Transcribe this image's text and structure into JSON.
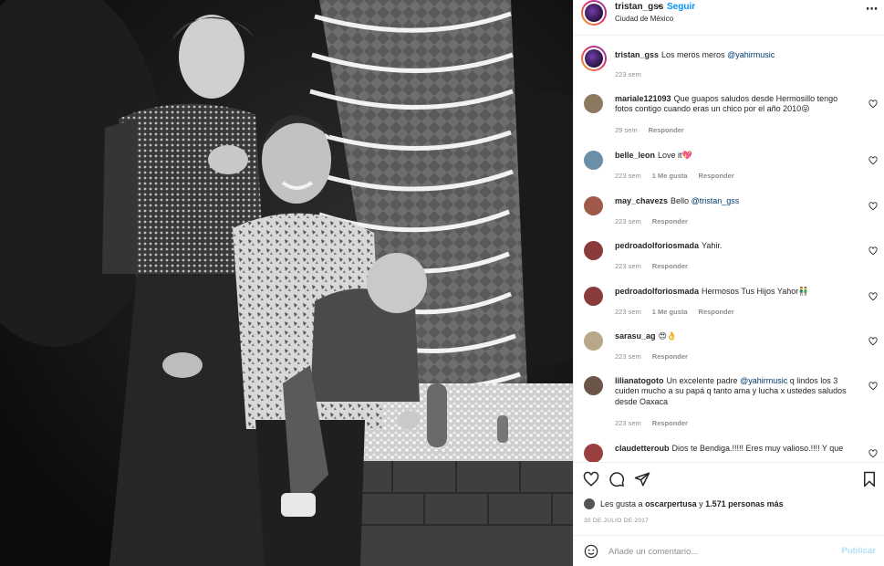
{
  "header": {
    "username": "tristan_gss",
    "separator": "•",
    "follow_label": "Seguir",
    "location": "Ciudad de México",
    "more_icon": "more-options-icon"
  },
  "caption": {
    "username": "tristan_gss",
    "text": "Los meros meros",
    "mention": "@yahirmusic",
    "time": "223 sem"
  },
  "comments": [
    {
      "username": "mariale121093",
      "text": "Que guapos saludos desde Hermosillo tengo fotos contigo cuando eras un chico por el año 2010😜",
      "mention": "",
      "time": "29 sem",
      "likes": "",
      "reply": "Responder",
      "avatar_color": "#8c7a60"
    },
    {
      "username": "belle_leon",
      "text": "Love it💖",
      "mention": "",
      "time": "223 sem",
      "likes": "1 Me gusta",
      "reply": "Responder",
      "avatar_color": "#6b8fa8"
    },
    {
      "username": "may_chavezs",
      "text": "Bello",
      "mention": "@tristan_gss",
      "time": "223 sem",
      "likes": "",
      "reply": "Responder",
      "avatar_color": "#a05a4a"
    },
    {
      "username": "pedroadolforiosmada",
      "text": "Yahir.",
      "mention": "",
      "time": "223 sem",
      "likes": "",
      "reply": "Responder",
      "avatar_color": "#8a3b3b"
    },
    {
      "username": "pedroadolforiosmada",
      "text": "Hermosos Tus Hijos Yahor👬",
      "mention": "",
      "time": "223 sem",
      "likes": "1 Me gusta",
      "reply": "Responder",
      "avatar_color": "#8a3b3b"
    },
    {
      "username": "sarasu_ag",
      "text": "😍👌",
      "mention": "",
      "time": "223 sem",
      "likes": "",
      "reply": "Responder",
      "avatar_color": "#b7a88a"
    },
    {
      "username": "lilianatogoto",
      "text": "Un excelente padre",
      "mention": "@yahirmusic",
      "text_after": "q lindos los 3 cuiden mucho a su papá q tanto ama y lucha x ustedes saludos desde Oaxaca",
      "time": "223 sem",
      "likes": "",
      "reply": "Responder",
      "avatar_color": "#6a5548"
    },
    {
      "username": "claudetteroub",
      "text": "Dios te Bendiga.!!!!! Eres muy valioso.!!!! Y que",
      "mention": "",
      "time": "",
      "likes": "",
      "reply": "",
      "avatar_color": "#9a4040"
    }
  ],
  "actions": {
    "like_icon": "heart-icon",
    "comment_icon": "comment-icon",
    "share_icon": "share-icon",
    "save_icon": "bookmark-icon"
  },
  "likes_line": {
    "prefix": "Les gusta a",
    "liker": "oscarpertusa",
    "connector": "y",
    "count": "1.571 personas más"
  },
  "date": "30 DE JULIO DE 2017",
  "add_comment": {
    "placeholder": "Añade un comentario...",
    "post_label": "Publicar",
    "emoji_icon": "emoji-icon"
  },
  "colors": {
    "link": "#0095f6",
    "mention": "#00376b",
    "muted": "#8e8e8e",
    "post_disabled": "#b2dffc"
  }
}
